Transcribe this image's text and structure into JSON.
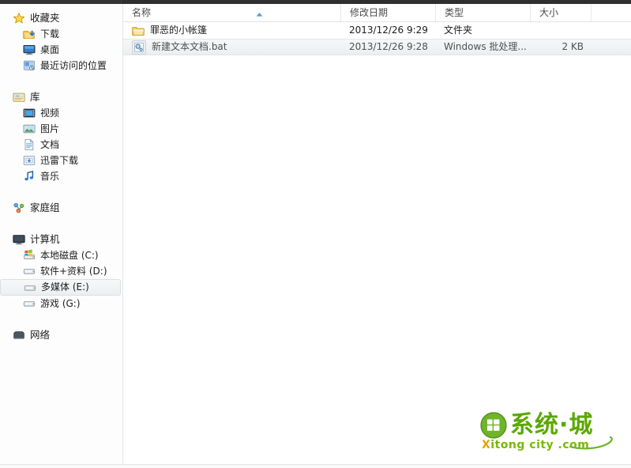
{
  "window": {
    "title": "多媒体 (E:)"
  },
  "nav_pane": {
    "groups": [
      {
        "name": "favorites",
        "header": {
          "label": "收藏夹",
          "icon": "star-icon"
        },
        "items": [
          {
            "label": "下载",
            "icon": "downloads-folder-icon"
          },
          {
            "label": "桌面",
            "icon": "desktop-icon"
          },
          {
            "label": "最近访问的位置",
            "icon": "recent-places-icon"
          }
        ]
      },
      {
        "name": "libraries",
        "header": {
          "label": "库",
          "icon": "library-icon"
        },
        "items": [
          {
            "label": "视频",
            "icon": "videos-icon"
          },
          {
            "label": "图片",
            "icon": "pictures-icon"
          },
          {
            "label": "文档",
            "icon": "documents-icon"
          },
          {
            "label": "迅雷下载",
            "icon": "thunder-download-icon"
          },
          {
            "label": "音乐",
            "icon": "music-icon"
          }
        ]
      },
      {
        "name": "homegroup",
        "header": {
          "label": "家庭组",
          "icon": "homegroup-icon"
        },
        "items": []
      },
      {
        "name": "computer",
        "header": {
          "label": "计算机",
          "icon": "computer-icon"
        },
        "items": [
          {
            "label": "本地磁盘 (C:)",
            "icon": "system-drive-icon",
            "selected": false
          },
          {
            "label": "软件+资料 (D:)",
            "icon": "drive-icon",
            "selected": false
          },
          {
            "label": "多媒体 (E:)",
            "icon": "drive-icon",
            "selected": true
          },
          {
            "label": "游戏 (G:)",
            "icon": "drive-icon",
            "selected": false
          }
        ]
      },
      {
        "name": "network",
        "header": {
          "label": "网络",
          "icon": "network-icon"
        },
        "items": []
      }
    ]
  },
  "file_list": {
    "columns": [
      {
        "key": "name",
        "label": "名称",
        "sorted": true,
        "sort_direction": "asc"
      },
      {
        "key": "date",
        "label": "修改日期"
      },
      {
        "key": "type",
        "label": "类型"
      },
      {
        "key": "size",
        "label": "大小"
      }
    ],
    "rows": [
      {
        "name": "罪恶的小帐篷",
        "date": "2013/12/26 9:29",
        "type": "文件夹",
        "size": "",
        "icon": "folder-icon",
        "selected": false
      },
      {
        "name": "新建文本文档.bat",
        "date": "2013/12/26 9:28",
        "type": "Windows 批处理...",
        "size": "2 KB",
        "icon": "bat-file-icon",
        "selected": true
      }
    ]
  },
  "watermark": {
    "chinese_text": "系统·城",
    "english_text_x": "X",
    "english_text_rest": "itong city .com",
    "brand_color": "#5aa800"
  }
}
